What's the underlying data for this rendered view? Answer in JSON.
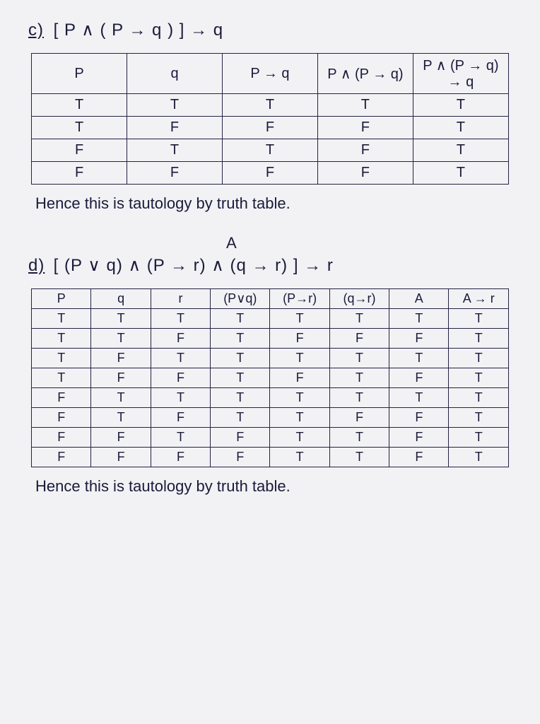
{
  "part_c": {
    "label": "c)",
    "expression": "[ P ∧ ( P → q ) ]  →  q",
    "headers": [
      "P",
      "q",
      "P → q",
      "P ∧ (P → q)",
      "P ∧ (P → q) → q"
    ],
    "rows": [
      [
        "T",
        "T",
        "T",
        "T",
        "T"
      ],
      [
        "T",
        "F",
        "F",
        "F",
        "T"
      ],
      [
        "F",
        "T",
        "T",
        "F",
        "T"
      ],
      [
        "F",
        "F",
        "F",
        "F",
        "T"
      ]
    ],
    "conclusion": "Hence this is tautology by truth table."
  },
  "part_d": {
    "label": "d)",
    "a_label": "A",
    "expression": "[ (P ∨ q) ∧ (P → r) ∧ (q → r) ]  →  r",
    "headers": [
      "P",
      "q",
      "r",
      "(P∨q)",
      "(P→r)",
      "(q→r)",
      "A",
      "A → r"
    ],
    "rows": [
      [
        "T",
        "T",
        "T",
        "T",
        "T",
        "T",
        "T",
        "T"
      ],
      [
        "T",
        "T",
        "F",
        "T",
        "F",
        "F",
        "F",
        "T"
      ],
      [
        "T",
        "F",
        "T",
        "T",
        "T",
        "T",
        "T",
        "T"
      ],
      [
        "T",
        "F",
        "F",
        "T",
        "F",
        "T",
        "F",
        "T"
      ],
      [
        "F",
        "T",
        "T",
        "T",
        "T",
        "T",
        "T",
        "T"
      ],
      [
        "F",
        "T",
        "F",
        "T",
        "T",
        "F",
        "F",
        "T"
      ],
      [
        "F",
        "F",
        "T",
        "F",
        "T",
        "T",
        "F",
        "T"
      ],
      [
        "F",
        "F",
        "F",
        "F",
        "T",
        "T",
        "F",
        "T"
      ]
    ],
    "conclusion": "Hence this is tautology by truth table."
  }
}
